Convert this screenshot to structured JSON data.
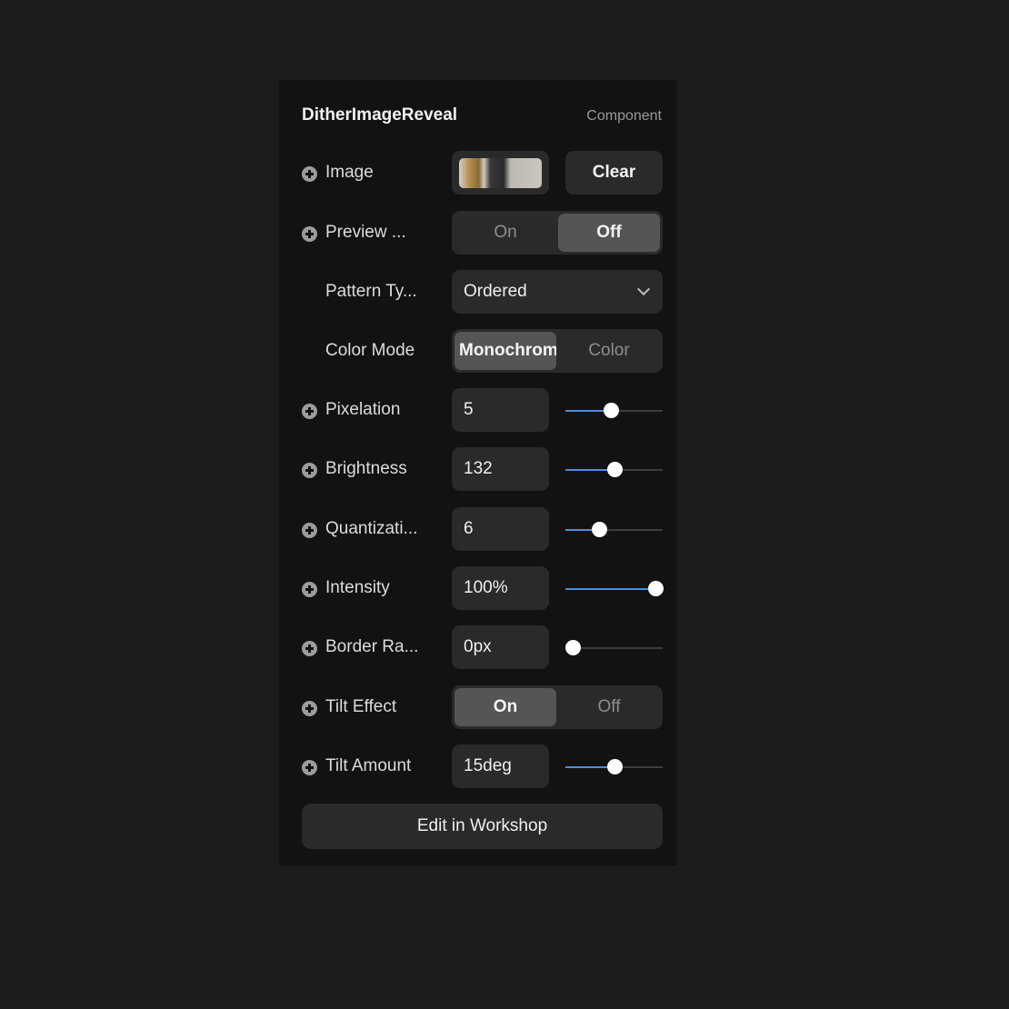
{
  "header": {
    "title": "DitherImageReveal",
    "tag": "Component"
  },
  "rows": {
    "image": {
      "label": "Image",
      "clear_label": "Clear"
    },
    "preview": {
      "label": "Preview ...",
      "options": [
        "On",
        "Off"
      ],
      "selected": "Off"
    },
    "pattern": {
      "label": "Pattern Ty...",
      "value": "Ordered"
    },
    "color_mode": {
      "label": "Color Mode",
      "options": [
        "Monochrome",
        "Color"
      ],
      "selected": "Monochrome"
    },
    "pixelation": {
      "label": "Pixelation",
      "value": "5",
      "fraction": 0.46
    },
    "brightness": {
      "label": "Brightness",
      "value": "132",
      "fraction": 0.51
    },
    "quantization": {
      "label": "Quantizati...",
      "value": "6",
      "fraction": 0.32
    },
    "intensity": {
      "label": "Intensity",
      "value": "100%",
      "fraction": 1.0
    },
    "border_radius": {
      "label": "Border Ra...",
      "value": "0px",
      "fraction": 0.0
    },
    "tilt_effect": {
      "label": "Tilt Effect",
      "options": [
        "On",
        "Off"
      ],
      "selected": "On"
    },
    "tilt_amount": {
      "label": "Tilt Amount",
      "value": "15deg",
      "fraction": 0.5
    }
  },
  "footer": {
    "workshop_label": "Edit in Workshop"
  },
  "colors": {
    "accent": "#4c8ee0",
    "panel": "#121212",
    "control": "#2a2a2a",
    "active": "#555555"
  }
}
